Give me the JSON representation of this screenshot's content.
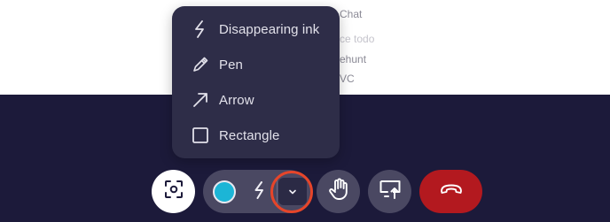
{
  "background": {
    "lines": [
      "Chat",
      "ce todo",
      "ehunt",
      "VC"
    ]
  },
  "menu": {
    "items": [
      {
        "label": "Disappearing ink",
        "icon": "bolt-icon"
      },
      {
        "label": "Pen",
        "icon": "pen-icon"
      },
      {
        "label": "Arrow",
        "icon": "arrow-icon"
      },
      {
        "label": "Rectangle",
        "icon": "rectangle-icon"
      }
    ]
  },
  "toolbar": {
    "focus": {
      "icon": "focus-frame-icon"
    },
    "color": {
      "value": "#1cb5d6",
      "icon": "color-swatch"
    },
    "tool": {
      "icon": "bolt-icon"
    },
    "dropdown": {
      "icon": "chevron-down-icon"
    },
    "raise_hand": {
      "icon": "hand-icon"
    },
    "share_screen": {
      "icon": "screen-share-icon"
    },
    "end_call": {
      "icon": "phone-hangup-icon",
      "color": "#b3191f"
    }
  },
  "colors": {
    "panel": "#1c1a3a",
    "menu": "#2e2d48",
    "highlight": "#e6452a"
  }
}
